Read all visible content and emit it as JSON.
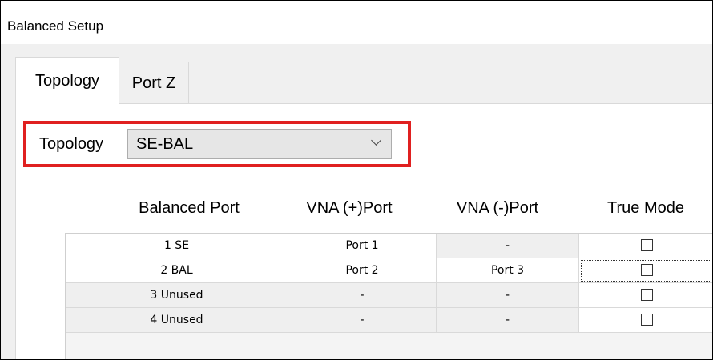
{
  "window": {
    "title": "Balanced Setup"
  },
  "tabs": [
    {
      "label": "Topology",
      "active": true
    },
    {
      "label": "Port Z",
      "active": false
    }
  ],
  "topology": {
    "label": "Topology",
    "selected": "SE-BAL",
    "highlight_color": "#e02020"
  },
  "table": {
    "columns": [
      "Balanced Port",
      "VNA (+)Port",
      "VNA (-)Port",
      "True Mode"
    ],
    "rows": [
      {
        "balanced_port": "1 SE",
        "plus_port": "Port 1",
        "minus_port": "-",
        "true_mode": false
      },
      {
        "balanced_port": "2 BAL",
        "plus_port": "Port 2",
        "minus_port": "Port 3",
        "true_mode": false
      },
      {
        "balanced_port": "3 Unused",
        "plus_port": "-",
        "minus_port": "-",
        "true_mode": false
      },
      {
        "balanced_port": "4 Unused",
        "plus_port": "-",
        "minus_port": "-",
        "true_mode": false
      }
    ]
  }
}
